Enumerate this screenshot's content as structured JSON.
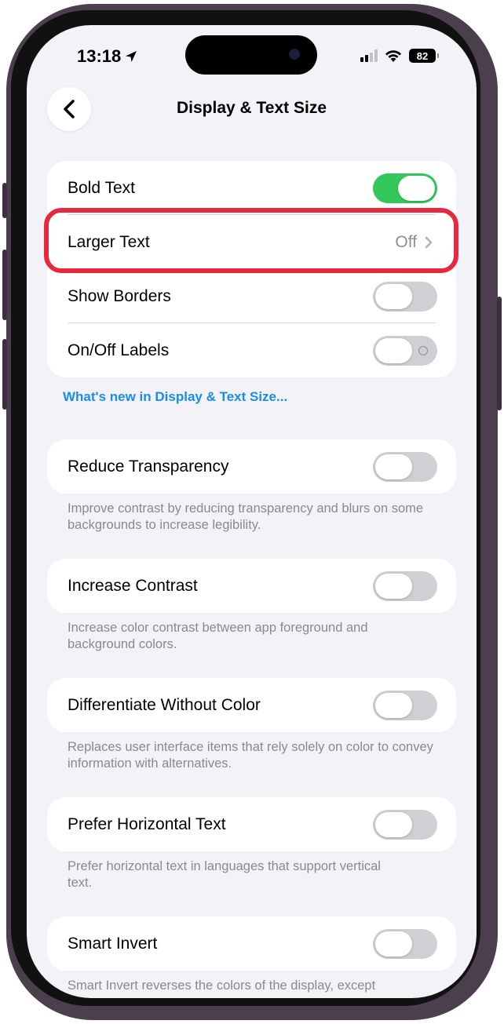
{
  "status_bar": {
    "time": "13:18",
    "battery": "82"
  },
  "nav": {
    "title": "Display & Text Size"
  },
  "group1": {
    "bold_text": {
      "label": "Bold Text",
      "state": "on"
    },
    "larger_text": {
      "label": "Larger Text",
      "value": "Off"
    },
    "show_borders": {
      "label": "Show Borders",
      "state": "off"
    },
    "on_off_labels": {
      "label": "On/Off Labels",
      "state": "off"
    }
  },
  "whats_new_link": "What's new in Display & Text Size...",
  "reduce_transparency": {
    "label": "Reduce Transparency",
    "description": "Improve contrast by reducing transparency and blurs on some backgrounds to increase legibility."
  },
  "increase_contrast": {
    "label": "Increase Contrast",
    "description": "Increase color contrast between app foreground and background colors."
  },
  "differentiate_without_color": {
    "label": "Differentiate Without Color",
    "description": "Replaces user interface items that rely solely on color to convey information with alternatives."
  },
  "prefer_horizontal_text": {
    "label": "Prefer Horizontal Text",
    "description": "Prefer horizontal text in languages that support vertical text."
  },
  "smart_invert": {
    "label": "Smart Invert",
    "description": "Smart Invert reverses the colors of the display, except"
  },
  "colors": {
    "toggle_on": "#34c759",
    "highlight": "#e8283f",
    "link": "#1a8cf0"
  },
  "icons": [
    "location-arrow-icon",
    "cellular-signal-icon",
    "wifi-icon",
    "battery-icon",
    "chevron-left-icon",
    "chevron-right-icon"
  ]
}
